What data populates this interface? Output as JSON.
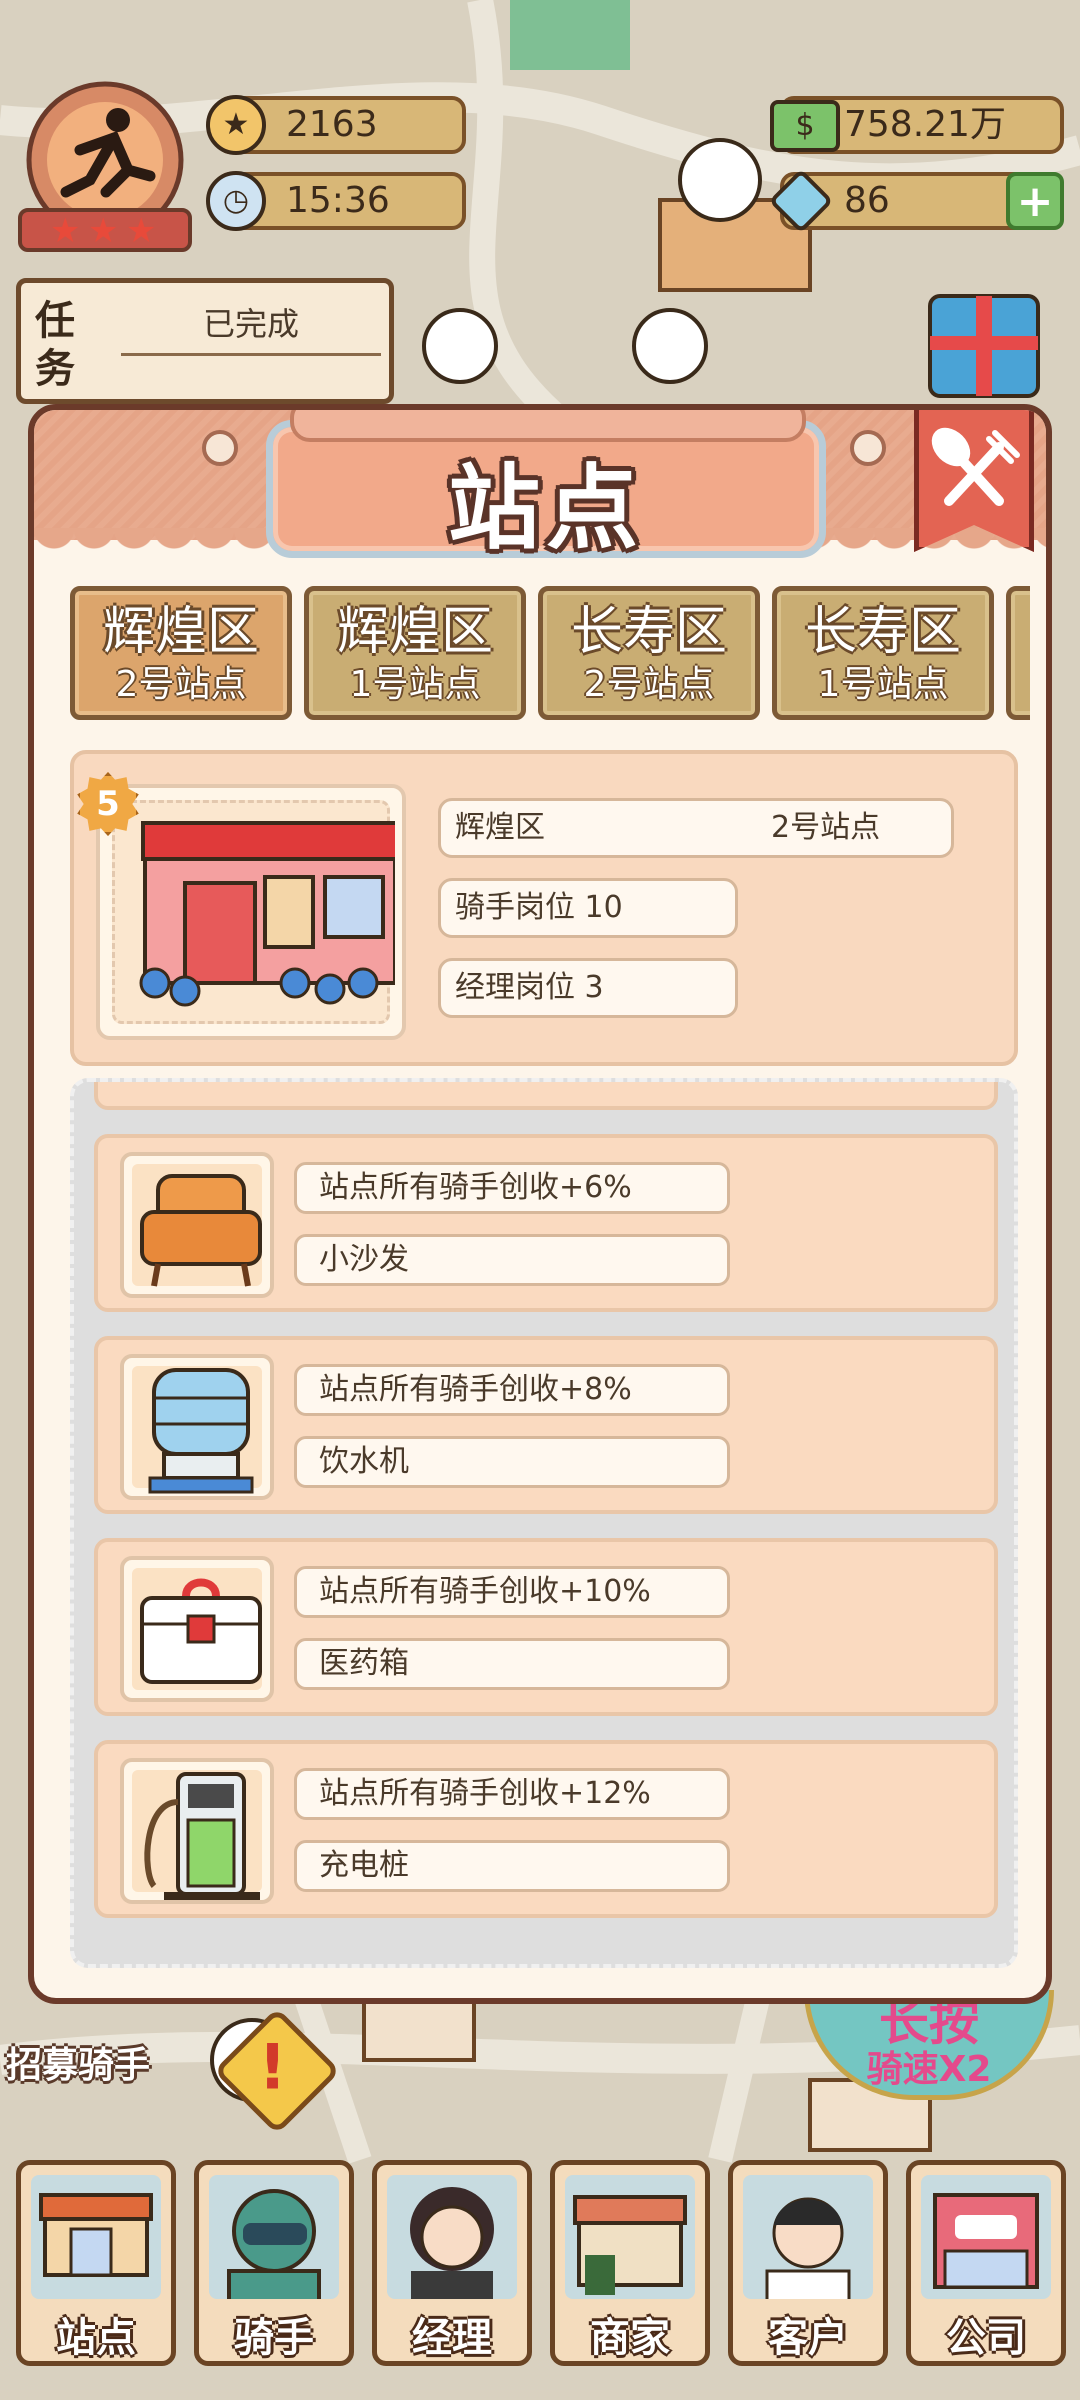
{
  "hud": {
    "stars": "2163",
    "time": "15:36",
    "money": "758.21万",
    "gems": "86",
    "plus_label": "+"
  },
  "task": {
    "label": "任务",
    "status": "已完成"
  },
  "modal": {
    "title": "站点",
    "tabs": [
      {
        "district": "辉煌区",
        "station": "2号站点",
        "active": true
      },
      {
        "district": "辉煌区",
        "station": "1号站点",
        "active": false
      },
      {
        "district": "长寿区",
        "station": "2号站点",
        "active": false
      },
      {
        "district": "长寿区",
        "station": "1号站点",
        "active": false
      }
    ],
    "station": {
      "level": "5",
      "district": "辉煌区",
      "name": "2号站点",
      "rider_slots": "骑手岗位 10",
      "manager_slots": "经理岗位 3"
    },
    "facilities": [
      {
        "bonus": "站点所有骑手创收+6%",
        "name": "小沙发",
        "icon": "armchair-icon"
      },
      {
        "bonus": "站点所有骑手创收+8%",
        "name": "饮水机",
        "icon": "water-dispenser-icon"
      },
      {
        "bonus": "站点所有骑手创收+10%",
        "name": "医药箱",
        "icon": "first-aid-kit-icon"
      },
      {
        "bonus": "站点所有骑手创收+12%",
        "name": "充电桩",
        "icon": "charging-pile-icon"
      }
    ]
  },
  "map": {
    "recruit_label": "招募骑手",
    "alert": "!",
    "speed_top": "长按",
    "speed_bottom": "骑速X2"
  },
  "nav": [
    {
      "label": "站点",
      "icon": "station-icon"
    },
    {
      "label": "骑手",
      "icon": "rider-icon"
    },
    {
      "label": "经理",
      "icon": "manager-icon"
    },
    {
      "label": "商家",
      "icon": "merchant-icon"
    },
    {
      "label": "客户",
      "icon": "customer-icon"
    },
    {
      "label": "公司",
      "icon": "company-icon"
    }
  ]
}
